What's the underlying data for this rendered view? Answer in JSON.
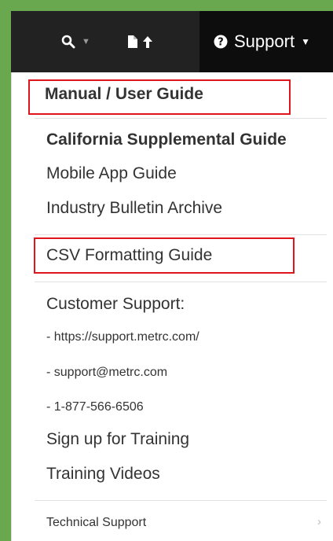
{
  "colors": {
    "frame_border": "#6aa84f",
    "navbar_bg": "#222222",
    "support_bg": "#0d0d0d",
    "highlight": "#e0141b",
    "menu_text": "#333333"
  },
  "navbar": {
    "search_icon": "search-icon",
    "upload_icon": "file-upload-icon",
    "support_icon": "question-circle-icon",
    "support_label": "Support"
  },
  "menu": {
    "manual": "Manual / User Guide",
    "california": "California Supplemental Guide",
    "mobile": "Mobile App Guide",
    "bulletin": "Industry Bulletin Archive",
    "csv": "CSV Formatting Guide",
    "customer_support": "Customer Support:",
    "support_url": "- https://support.metrc.com/",
    "support_email": "- support@metrc.com",
    "support_phone": "- 1-877-566-6506",
    "training_signup": "Sign up for Training",
    "training_videos": "Training Videos",
    "technical_support": "Technical Support"
  }
}
